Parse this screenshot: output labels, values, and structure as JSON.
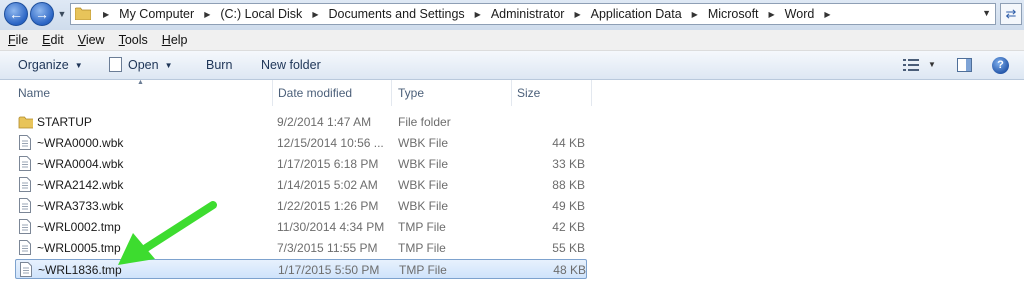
{
  "address_bar": {
    "crumbs": [
      "My Computer",
      "(C:) Local Disk",
      "Documents and Settings",
      "Administrator",
      "Application Data",
      "Microsoft",
      "Word"
    ]
  },
  "menu": {
    "file": "File",
    "edit": "Edit",
    "view": "View",
    "tools": "Tools",
    "help": "Help"
  },
  "toolbar": {
    "organize": "Organize",
    "open": "Open",
    "burn": "Burn",
    "new_folder": "New folder"
  },
  "columns": {
    "name": "Name",
    "date": "Date modified",
    "type": "Type",
    "size": "Size"
  },
  "files": [
    {
      "name": "STARTUP",
      "date": "9/2/2014 1:47 AM",
      "type": "File folder",
      "size": "",
      "icon": "folder-icon"
    },
    {
      "name": "~WRA0000.wbk",
      "date": "12/15/2014 10:56 ...",
      "type": "WBK File",
      "size": "44 KB",
      "icon": "file-icon"
    },
    {
      "name": "~WRA0004.wbk",
      "date": "1/17/2015 6:18 PM",
      "type": "WBK File",
      "size": "33 KB",
      "icon": "file-icon"
    },
    {
      "name": "~WRA2142.wbk",
      "date": "1/14/2015 5:02 AM",
      "type": "WBK File",
      "size": "88 KB",
      "icon": "file-icon"
    },
    {
      "name": "~WRA3733.wbk",
      "date": "1/22/2015 1:26 PM",
      "type": "WBK File",
      "size": "49 KB",
      "icon": "file-icon"
    },
    {
      "name": "~WRL0002.tmp",
      "date": "11/30/2014 4:34 PM",
      "type": "TMP File",
      "size": "42 KB",
      "icon": "file-icon"
    },
    {
      "name": "~WRL0005.tmp",
      "date": "7/3/2015 11:55 PM",
      "type": "TMP File",
      "size": "55 KB",
      "icon": "file-icon"
    },
    {
      "name": "~WRL1836.tmp",
      "date": "1/17/2015 5:50 PM",
      "type": "TMP File",
      "size": "48 KB",
      "icon": "file-icon",
      "selected": true
    }
  ],
  "colors": {
    "selection": "#cfe3fb",
    "selection_border": "#7da2ce",
    "annotation_arrow": "#3ddc2f"
  }
}
